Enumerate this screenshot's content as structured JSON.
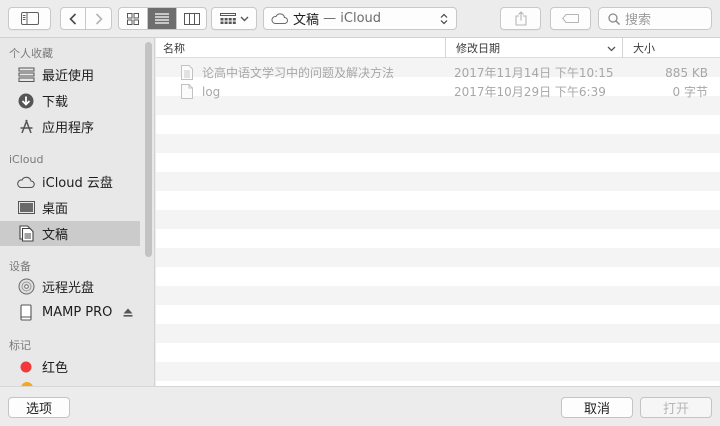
{
  "toolbar": {
    "location": "文稿",
    "location_sep": " — ",
    "location_service": "iCloud",
    "search_placeholder": "搜索"
  },
  "sidebar": {
    "sections": [
      {
        "title": "个人收藏",
        "items": [
          {
            "label": "最近使用",
            "icon": "clock-icon"
          },
          {
            "label": "下载",
            "icon": "download-icon"
          },
          {
            "label": "应用程序",
            "icon": "applications-icon"
          }
        ]
      },
      {
        "title": "iCloud",
        "items": [
          {
            "label": "iCloud 云盘",
            "icon": "cloud-icon"
          },
          {
            "label": "桌面",
            "icon": "desktop-icon"
          },
          {
            "label": "文稿",
            "icon": "document-icon",
            "selected": true
          }
        ]
      },
      {
        "title": "设备",
        "items": [
          {
            "label": "远程光盘",
            "icon": "disc-icon"
          },
          {
            "label": "MAMP PRO",
            "icon": "drive-icon"
          }
        ]
      },
      {
        "title": "标记",
        "items": [
          {
            "label": "红色",
            "icon": "red-tag-icon",
            "color": "#f0393a"
          }
        ]
      }
    ]
  },
  "columns": {
    "name": "名称",
    "date": "修改日期",
    "size": "大小"
  },
  "files": [
    {
      "name": "论高中语文学习中的问题及解决方法",
      "date": "2017年11月14日 下午10:15",
      "size": "885 KB"
    },
    {
      "name": "log",
      "date": "2017年10月29日 下午6:39",
      "size": "0 字节"
    }
  ],
  "footer": {
    "options": "选项",
    "cancel": "取消",
    "open": "打开"
  },
  "colors": {
    "selection": "#cbcbcb",
    "active_view": "#6e6e6e",
    "tag_red": "#f0393a",
    "tag_orange": "#f5a623"
  }
}
